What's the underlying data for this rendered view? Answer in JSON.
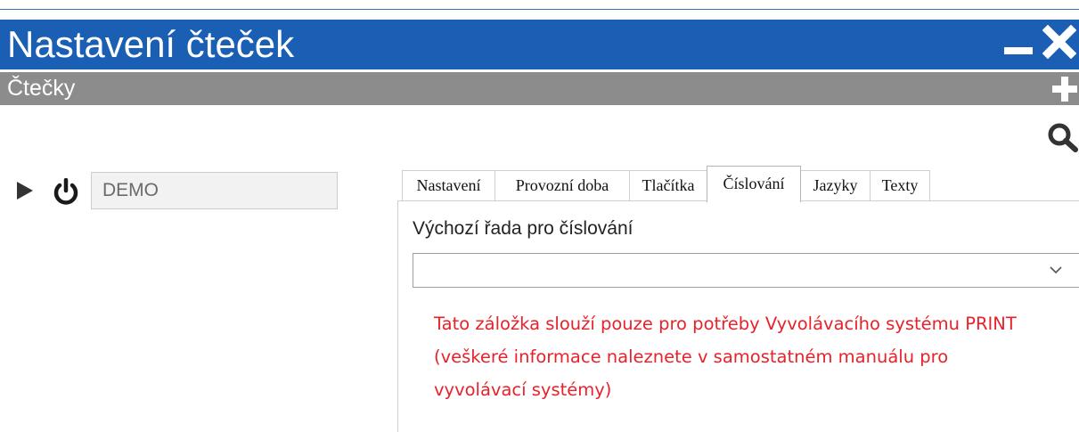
{
  "window": {
    "title": "Nastavení čteček",
    "subtitle": "Čtečky"
  },
  "reader": {
    "name": "DEMO"
  },
  "tabs": [
    {
      "label": "Nastavení"
    },
    {
      "label": "Provozní doba"
    },
    {
      "label": "Tlačítka"
    },
    {
      "label": "Číslování",
      "active": true
    },
    {
      "label": "Jazyky"
    },
    {
      "label": "Texty"
    }
  ],
  "numbering": {
    "label": "Výchozí řada pro číslování",
    "selected": "",
    "notice_lines": [
      "Tato záložka slouží pouze pro potřeby Vyvolávacího systému PRINT",
      "(veškeré informace naleznete v samostatném manuálu pro",
      "vyvolávací systémy)"
    ]
  },
  "colors": {
    "titlebar": "#1a5fb4",
    "subbar": "#8c8c8c",
    "notice": "#e8222b"
  },
  "icons": [
    "minimize-icon",
    "close-icon",
    "add-icon",
    "search-icon",
    "play-icon",
    "power-icon",
    "chevron-down-icon"
  ]
}
